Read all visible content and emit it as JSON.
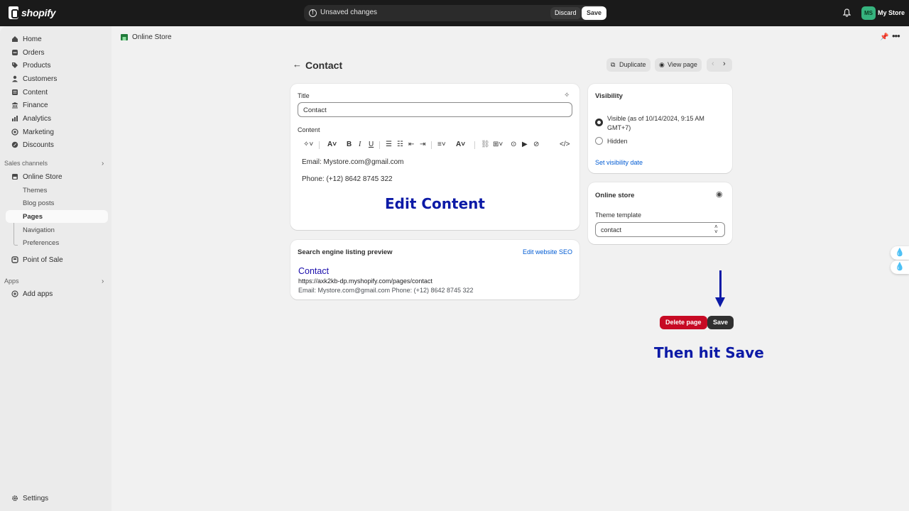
{
  "topbar": {
    "logo_text": "shopify",
    "unsaved_label": "Unsaved changes",
    "discard_label": "Discard",
    "save_label": "Save",
    "store_initials": "MS",
    "store_name": "My Store"
  },
  "sidebar": {
    "items": [
      {
        "label": "Home",
        "icon": "home-icon"
      },
      {
        "label": "Orders",
        "icon": "orders-icon"
      },
      {
        "label": "Products",
        "icon": "tag-icon"
      },
      {
        "label": "Customers",
        "icon": "person-icon"
      },
      {
        "label": "Content",
        "icon": "content-icon"
      },
      {
        "label": "Finance",
        "icon": "finance-icon"
      },
      {
        "label": "Analytics",
        "icon": "analytics-icon"
      },
      {
        "label": "Marketing",
        "icon": "target-icon"
      },
      {
        "label": "Discounts",
        "icon": "discount-icon"
      }
    ],
    "sales_channels_label": "Sales channels",
    "online_store_label": "Online Store",
    "sub_items": [
      "Themes",
      "Blog posts",
      "Pages",
      "Navigation",
      "Preferences"
    ],
    "point_of_sale_label": "Point of Sale",
    "apps_label": "Apps",
    "add_apps_label": "Add apps",
    "settings_label": "Settings"
  },
  "breadcrumb": {
    "label": "Online Store"
  },
  "page": {
    "title": "Contact",
    "duplicate_label": "Duplicate",
    "view_page_label": "View page"
  },
  "editor": {
    "title_label": "Title",
    "title_value": "Contact",
    "content_label": "Content",
    "content_lines": [
      "Email: Mystore.com@gmail.com",
      "Phone: (+12) 8642 8745 322"
    ],
    "overlay_text": "Edit Content"
  },
  "seo": {
    "heading": "Search engine listing preview",
    "edit_link": "Edit website SEO",
    "preview_title": "Contact",
    "preview_url": "https://axk2kb-dp.myshopify.com/pages/contact",
    "preview_desc": "Email: Mystore.com@gmail.com Phone: (+12) 8642 8745 322"
  },
  "visibility": {
    "heading": "Visibility",
    "visible_label": "Visible (as of 10/14/2024, 9:15 AM GMT+7)",
    "hidden_label": "Hidden",
    "set_date_link": "Set visibility date"
  },
  "online_store_card": {
    "heading": "Online store",
    "theme_template_label": "Theme template",
    "theme_template_value": "contact"
  },
  "actions": {
    "delete_label": "Delete page",
    "save_label": "Save",
    "overlay_text": "Then hit Save"
  },
  "colors": {
    "topbar": "#1a1a1a",
    "accent_overlay": "#0c1aa6",
    "delete": "#c70a24",
    "link": "#005bd3"
  }
}
